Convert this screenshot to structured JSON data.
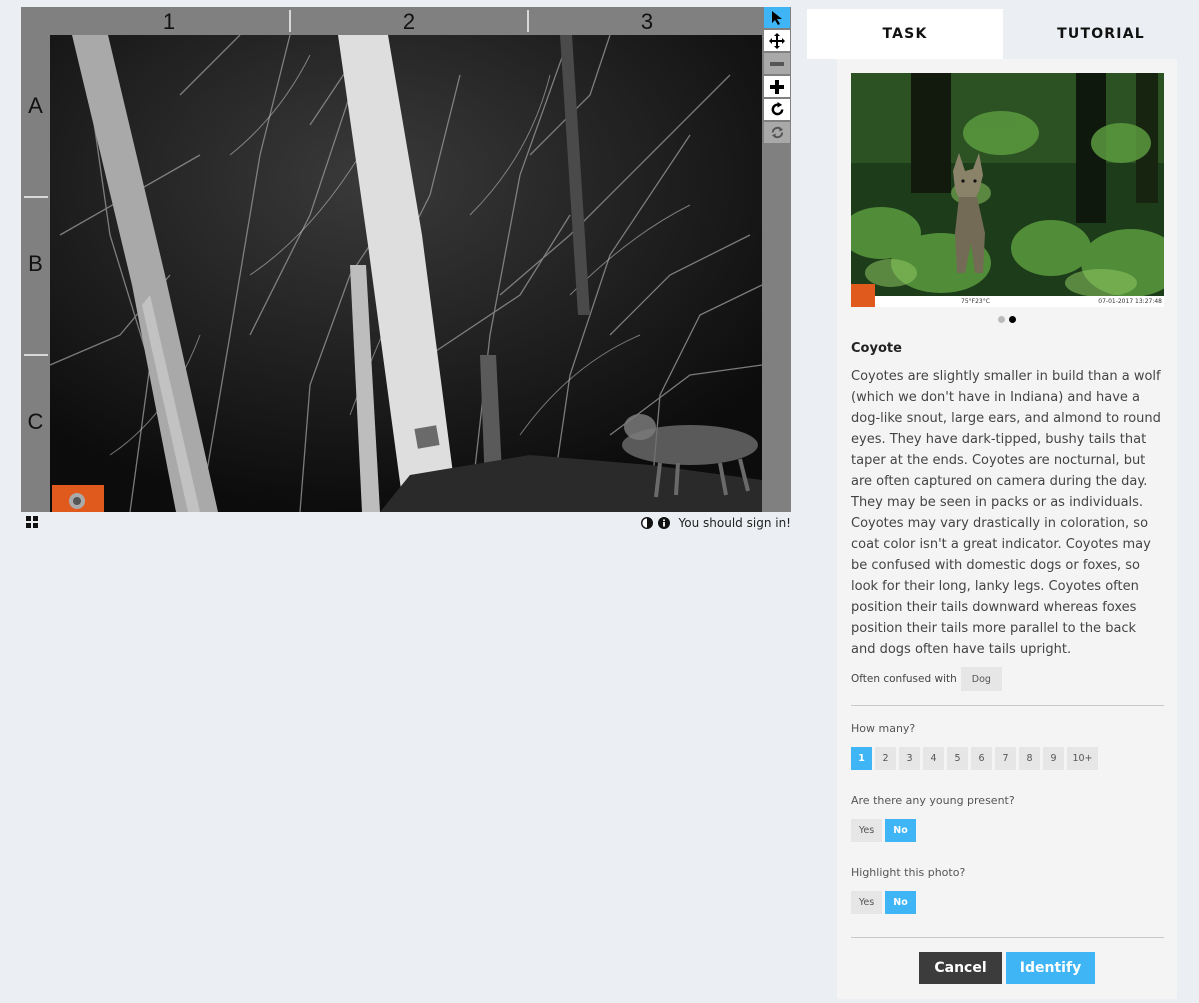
{
  "viewer": {
    "columns": [
      "1",
      "2",
      "3"
    ],
    "rows": [
      "A",
      "B",
      "C"
    ],
    "tools": [
      "pointer-icon",
      "move-icon",
      "zoom-out-icon",
      "zoom-in-icon",
      "rotate-icon",
      "reset-icon"
    ],
    "signin_text": "You should sign in!"
  },
  "tabs": {
    "task": "TASK",
    "tutorial": "TUTORIAL"
  },
  "species": {
    "name": "Coyote",
    "description": "Coyotes are slightly smaller in build than a wolf (which we don't have in Indiana) and have a dog-like snout, large ears, and almond to round eyes. They have dark-tipped, bushy tails that taper at the ends. Coyotes are nocturnal, but are often captured on camera during the day. They may be seen in packs or as individuals. Coyotes may vary drastically in coloration, so coat color isn't a great indicator. Coyotes may be confused with domestic dogs or foxes, so look for their long, lanky legs. Coyotes often position their tails downward whereas foxes position their tails more parallel to the back and dogs often have tails upright.",
    "image_stamp_temp": "75°F23°C",
    "image_stamp_date": "07-01-2017 13:27:48",
    "confused_label": "Often confused with",
    "confused_with": "Dog"
  },
  "questions": {
    "how_many": {
      "label": "How many?",
      "options": [
        "1",
        "2",
        "3",
        "4",
        "5",
        "6",
        "7",
        "8",
        "9",
        "10+"
      ],
      "selected": "1"
    },
    "young": {
      "label": "Are there any young present?",
      "yes": "Yes",
      "no": "No",
      "selected": "No"
    },
    "highlight": {
      "label": "Highlight this photo?",
      "yes": "Yes",
      "no": "No",
      "selected": "No"
    }
  },
  "actions": {
    "cancel": "Cancel",
    "identify": "Identify"
  },
  "colors": {
    "accent": "#3fb5f5",
    "cancel_bg": "#3c3c3c",
    "bushnell_orange": "#e05a1e"
  }
}
